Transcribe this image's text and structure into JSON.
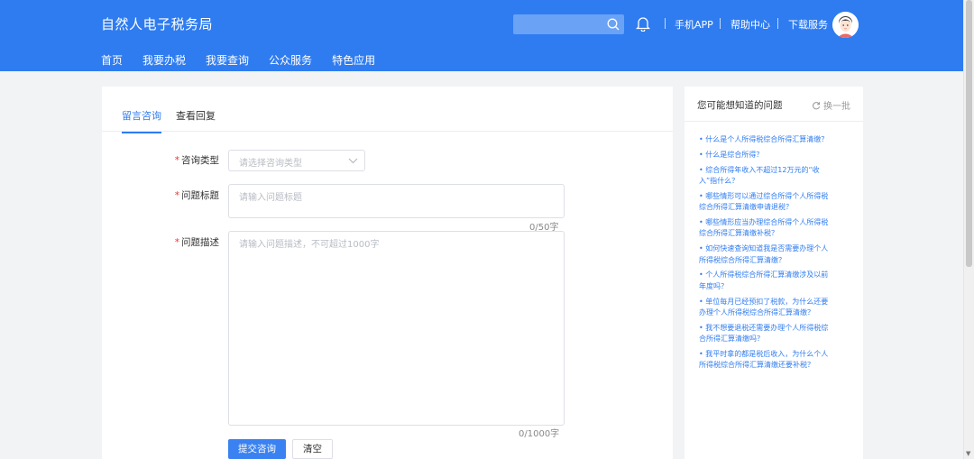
{
  "header": {
    "brand": "自然人电子税务局",
    "search": {
      "placeholder": ""
    },
    "links": [
      "手机APP",
      "帮助中心",
      "下载服务"
    ],
    "accent": "#2f7cf0"
  },
  "nav": [
    "首页",
    "我要办税",
    "我要查询",
    "公众服务",
    "特色应用"
  ],
  "main": {
    "tabs": [
      {
        "label": "留言咨询",
        "active": true
      },
      {
        "label": "查看回复",
        "active": false
      }
    ],
    "form": {
      "type": {
        "required_mark": "*",
        "label": "咨询类型",
        "placeholder": "请选择咨询类型"
      },
      "title": {
        "required_mark": "*",
        "label": "问题标题",
        "placeholder": "请输入问题标题",
        "counter": "0/50字"
      },
      "desc": {
        "required_mark": "*",
        "label": "问题描述",
        "placeholder": "请输入问题描述，不可超过1000字",
        "counter": "0/1000字"
      }
    },
    "buttons": {
      "submit": "提交咨询",
      "clear": "清空"
    }
  },
  "side": {
    "title": "您可能想知道的问题",
    "refresh_label": "换一批",
    "questions": [
      [
        "• 什么是个人所得税综合所得汇算清缴？"
      ],
      [
        "• 什么是综合所得？"
      ],
      [
        "• 综合所得年收入不超过12万元的“收",
        "入”指什么？"
      ],
      [
        "• 哪些情形可以通过综合所得个人所得税",
        "综合所得汇算清缴申请退税？"
      ],
      [
        "• 哪些情形应当办理综合所得个人所得税",
        "综合所得汇算清缴补税？"
      ],
      [
        "• 如何快速查询知道我是否需要办理个人",
        "所得税综合所得汇算清缴？"
      ],
      [
        "• 个人所得税综合所得汇算清缴涉及以前",
        "年度吗？"
      ],
      [
        "• 单位每月已经预扣了税款，为什么还要",
        "办理个人所得税综合所得汇算清缴？"
      ],
      [
        "• 我不想要退税还需要办理个人所得税综",
        "合所得汇算清缴吗？"
      ],
      [
        "• 我平时拿的都是税后收入，为什么个人",
        "所得税综合所得汇算清缴还要补税？"
      ]
    ]
  }
}
